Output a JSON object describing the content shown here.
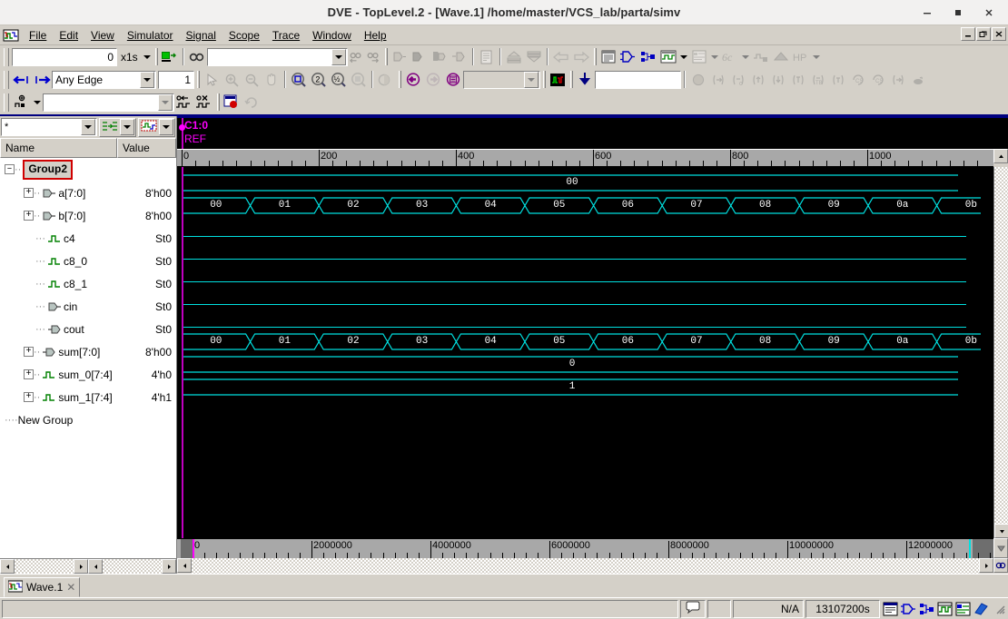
{
  "window": {
    "title": "DVE - TopLevel.2 - [Wave.1]  /home/master/VCS_lab/parta/simv",
    "minimize": "—",
    "maximize": "□",
    "close": "✕",
    "mdi_minimize": "_",
    "mdi_restore": "❐",
    "mdi_close": "✕"
  },
  "menu": {
    "items": [
      {
        "label": "File",
        "accel": "F"
      },
      {
        "label": "Edit",
        "accel": "E"
      },
      {
        "label": "View",
        "accel": "V"
      },
      {
        "label": "Simulator",
        "accel": "m"
      },
      {
        "label": "Signal",
        "accel": "S"
      },
      {
        "label": "Scope",
        "accel": "c"
      },
      {
        "label": "Trace",
        "accel": "T"
      },
      {
        "label": "Window",
        "accel": "W"
      },
      {
        "label": "Help",
        "accel": "H"
      }
    ]
  },
  "toolbar1": {
    "time_value": "0",
    "time_unit": "x1s",
    "search_value": "",
    "search_placeholder": "",
    "icons": [
      "goto-time-icon",
      "find-icon",
      "find-prev-icon",
      "find-next-icon",
      "expand-bus-icon",
      "collapse-bus-icon",
      "group-signal-icon",
      "ungroup-signal-icon",
      "report-icon",
      "raise-icon",
      "lower-icon",
      "back-icon",
      "forward-icon",
      "list-window-icon",
      "schematic-icon",
      "path-schematic-icon",
      "wave-window-icon",
      "source-window-icon",
      "assertion-icon",
      "memory-icon",
      "stack-icon",
      "hierarchy-icon"
    ]
  },
  "toolbar2": {
    "edge_prev_icon": "prev-edge-icon",
    "edge_next_icon": "next-edge-icon",
    "edge_mode": "Any Edge",
    "edge_count": "1",
    "zoom_value": "",
    "icons": [
      "select-mode-icon",
      "zoom-in-icon",
      "zoom-out-icon",
      "pan-icon",
      "zoom-fit-icon",
      "zoom-2x-icon",
      "zoom-half-icon",
      "zoom-cursor-icon",
      "compare-icon",
      "prev-cursor-icon",
      "next-cursor-icon",
      "cursor-list-icon",
      "wave-compare-icon",
      "save-down-icon"
    ],
    "right_icons": [
      "breakpoint-icon",
      "step-icon",
      "step-c-icon",
      "step-brace-icon",
      "step-t-icon",
      "step-up-t-icon",
      "step-tb-icon",
      "step-cc-icon",
      "continue-icon",
      "continue-2-icon",
      "step-out-icon",
      "finish-icon"
    ]
  },
  "toolbar3": {
    "marker_icon": "set-marker-icon",
    "combo_value": "",
    "icons": [
      "prev-transition-icon",
      "delete-transition-icon",
      "record-icon",
      "refresh-icon"
    ]
  },
  "signal_panel": {
    "filter_value": "*",
    "filter_placeholder": "*",
    "sort_icon": "sort-signals-icon",
    "view_icon": "wave-view-icon",
    "columns": {
      "name": "Name",
      "value": "Value"
    },
    "group_label": "Group2",
    "new_group_label": "New Group",
    "rows": [
      {
        "name": "a[7:0]",
        "value": "8'h00",
        "icon": "input-port-icon",
        "expandable": true,
        "indent": 1
      },
      {
        "name": "b[7:0]",
        "value": "8'h00",
        "icon": "input-port-icon",
        "expandable": true,
        "indent": 1
      },
      {
        "name": "c4",
        "value": "St0",
        "icon": "wire-icon",
        "expandable": false,
        "indent": 1
      },
      {
        "name": "c8_0",
        "value": "St0",
        "icon": "wire-icon",
        "expandable": false,
        "indent": 1
      },
      {
        "name": "c8_1",
        "value": "St0",
        "icon": "wire-icon",
        "expandable": false,
        "indent": 1
      },
      {
        "name": "cin",
        "value": "St0",
        "icon": "input-port-icon",
        "expandable": false,
        "indent": 1
      },
      {
        "name": "cout",
        "value": "St0",
        "icon": "output-port-icon",
        "expandable": false,
        "indent": 1
      },
      {
        "name": "sum[7:0]",
        "value": "8'h00",
        "icon": "output-port-icon",
        "expandable": true,
        "indent": 1
      },
      {
        "name": "sum_0[7:4]",
        "value": "4'h0",
        "icon": "wire-icon",
        "expandable": true,
        "indent": 1
      },
      {
        "name": "sum_1[7:4]",
        "value": "4'h1",
        "icon": "wire-icon",
        "expandable": true,
        "indent": 1
      }
    ]
  },
  "wave": {
    "cursor_label": "C1:0",
    "ref_label": "REF",
    "ruler": {
      "labels": [
        "0",
        "200",
        "400",
        "600",
        "800",
        "1000"
      ],
      "major_positions": [
        0,
        151,
        302,
        453,
        604,
        755
      ],
      "minor_step": 15.1
    },
    "overview": {
      "labels": [
        "0",
        "2000000",
        "4000000",
        "6000000",
        "8000000",
        "10000000",
        "12000000"
      ],
      "major_positions": [
        17,
        148,
        279,
        410,
        541,
        672,
        803
      ],
      "minor_step": 13.1
    },
    "rows": [
      {
        "signal": "a[7:0]",
        "type": "bus-constant",
        "value": "00"
      },
      {
        "signal": "b[7:0]",
        "type": "bus-series",
        "values": [
          "00",
          "01",
          "02",
          "03",
          "04",
          "05",
          "06",
          "07",
          "08",
          "09",
          "0a",
          "0b"
        ]
      },
      {
        "signal": "c4",
        "type": "flat-low"
      },
      {
        "signal": "c8_0",
        "type": "flat-low"
      },
      {
        "signal": "c8_1",
        "type": "flat-low"
      },
      {
        "signal": "cin",
        "type": "flat-low"
      },
      {
        "signal": "cout",
        "type": "flat-low"
      },
      {
        "signal": "sum[7:0]",
        "type": "bus-series",
        "values": [
          "00",
          "01",
          "02",
          "03",
          "04",
          "05",
          "06",
          "07",
          "08",
          "09",
          "0a",
          "0b"
        ]
      },
      {
        "signal": "sum_0[7:4]",
        "type": "bus-constant",
        "value": "0"
      },
      {
        "signal": "sum_1[7:4]",
        "type": "bus-constant",
        "value": "1"
      }
    ]
  },
  "tabs": [
    {
      "label": "Wave.1",
      "icon": "wave-tab-icon",
      "close": "✕",
      "active": true
    }
  ],
  "statusbar": {
    "message": "",
    "hint": "",
    "na": "N/A",
    "time": "13107200s",
    "icons": [
      "list-pane-icon",
      "schematic-pane-icon",
      "path-pane-icon",
      "wave-pane-icon",
      "source-pane-icon",
      "assertion-pane-icon"
    ]
  },
  "colors": {
    "face": "#d4d0c8",
    "wave_bg": "#000000",
    "wave_signal": "#00e0e0",
    "cursor": "#ff00ff",
    "group_outline": "#d00000",
    "accent_blue": "#000080",
    "ruler_bg": "#a8a8a8"
  }
}
